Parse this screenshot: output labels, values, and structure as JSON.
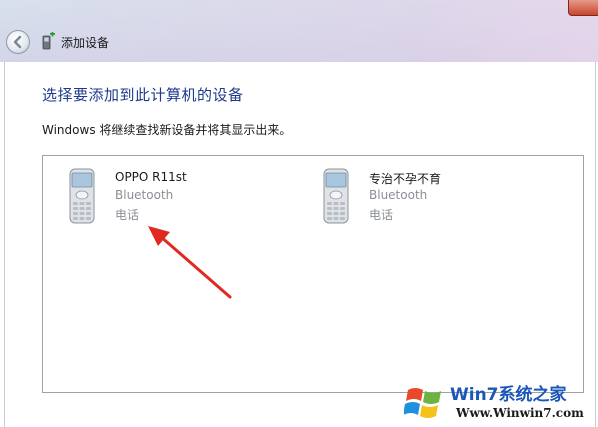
{
  "window": {
    "title": "添加设备"
  },
  "heading": "选择要添加到此计算机的设备",
  "subtext": "Windows 将继续查找新设备并将其显示出来。",
  "devices": [
    {
      "name": "OPPO R11st",
      "type": "Bluetooth",
      "category": "电话",
      "icon": "mobile-phone-icon"
    },
    {
      "name": "专治不孕不育",
      "type": "Bluetooth",
      "category": "电话",
      "icon": "mobile-phone-icon"
    }
  ],
  "annotation": {
    "icon": "red-arrow-pointer",
    "color": "#e0291f"
  },
  "watermark": {
    "brand": "Win7系统之家",
    "url": "Www.Winwin7.com"
  },
  "colors": {
    "heading": "#1e3a8c",
    "secondary_text": "#8a8f96",
    "list_border": "#9aa3ad"
  }
}
